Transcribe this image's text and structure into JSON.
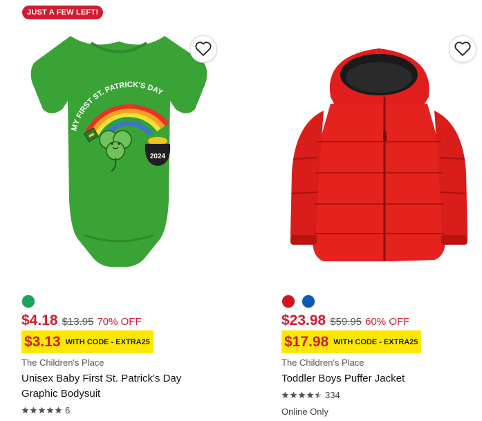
{
  "products": [
    {
      "badge": "JUST A FEW LEFT!",
      "swatch_colors": [
        "#1aa35a"
      ],
      "price": "$4.18",
      "original_price": "$13.95",
      "discount": "70% OFF",
      "promo_price": "$3.13",
      "promo_text": "WITH CODE - EXTRA25",
      "brand": "The Children's Place",
      "title": "Unisex Baby First St. Patrick's Day Graphic Bodysuit",
      "rating_stars": 5,
      "review_count": "6",
      "image_text": {
        "shirt_text": "MY FIRST ST. PATRICK'S DAY",
        "pot_text": "2024"
      }
    },
    {
      "swatch_colors": [
        "#d6121f",
        "#0b5bb5"
      ],
      "price": "$23.98",
      "original_price": "$59.95",
      "discount": "60% OFF",
      "promo_price": "$17.98",
      "promo_text": "WITH CODE - EXTRA25",
      "brand": "The Children's Place",
      "title": "Toddler Boys Puffer Jacket",
      "rating_stars": 4.5,
      "review_count": "334",
      "availability": "Online Only"
    }
  ],
  "icons": {
    "favorite": "heart-outline-icon",
    "rating": "star-icon"
  }
}
